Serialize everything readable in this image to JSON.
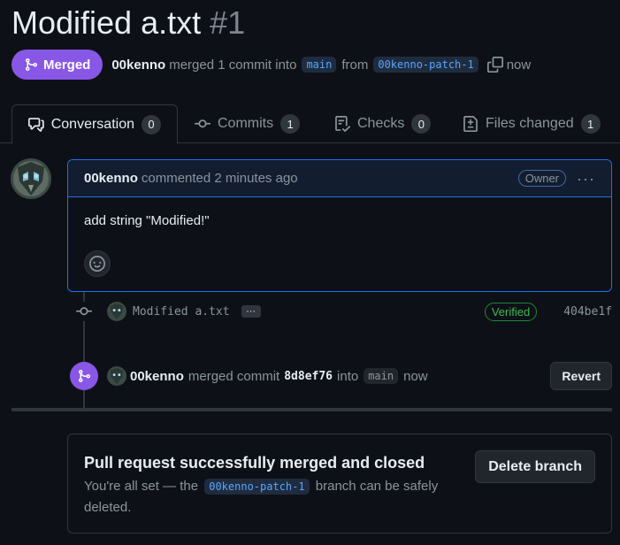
{
  "pr": {
    "title": "Modified a.txt",
    "number": "#1",
    "state": "Merged",
    "author": "00kenno",
    "summary_merged": "merged 1 commit into",
    "base_branch": "main",
    "summary_from": "from",
    "head_branch": "00kenno-patch-1",
    "time": "now"
  },
  "tabs": [
    {
      "label": "Conversation",
      "count": "0",
      "icon": "comment-discussion-icon"
    },
    {
      "label": "Commits",
      "count": "1",
      "icon": "git-commit-icon"
    },
    {
      "label": "Checks",
      "count": "0",
      "icon": "checklist-icon"
    },
    {
      "label": "Files changed",
      "count": "1",
      "icon": "file-diff-icon"
    }
  ],
  "comment": {
    "author": "00kenno",
    "action": "commented 2 minutes ago",
    "badge": "Owner",
    "menu": "···",
    "body": "add string \"Modified!\""
  },
  "commit": {
    "message": "Modified a.txt",
    "ellipsis": "···",
    "verified": "Verified",
    "sha": "404be1f"
  },
  "merge_event": {
    "author": "00kenno",
    "text": "merged commit",
    "sha": "8d8ef76",
    "into": "into",
    "branch": "main",
    "time": "now",
    "revert_label": "Revert"
  },
  "merge_box": {
    "title": "Pull request successfully merged and closed",
    "text_before": "You're all set — the",
    "branch": "00kenno-patch-1",
    "text_after": "branch can be safely deleted.",
    "delete_label": "Delete branch"
  },
  "colors": {
    "background": "#0d1117",
    "merged_purple": "#8957e5",
    "accent_blue": "#1f6feb",
    "verified_green": "#3fb950"
  }
}
